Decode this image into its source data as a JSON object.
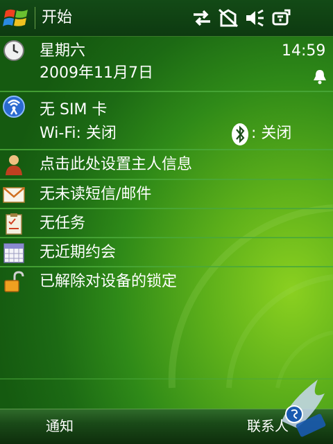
{
  "titlebar": {
    "title": "开始",
    "status_icons": [
      "connectivity-arrows-icon",
      "no-phone-icon",
      "speaker-mute-icon",
      "battery-plug-icon"
    ]
  },
  "today": {
    "date": {
      "weekday": "星期六",
      "date": "2009年11月7日",
      "time": "14:59",
      "icon": "clock-icon",
      "alarm_icon": "bell-icon"
    },
    "connectivity": {
      "sim": "无 SIM 卡",
      "wifi_label": "Wi-Fi:",
      "wifi_status": "关闭",
      "bt_status": ": 关闭",
      "icon": "wireless-icon",
      "bt_icon": "bluetooth-icon"
    },
    "items": [
      {
        "label": "点击此处设置主人信息",
        "icon": "owner-person-icon"
      },
      {
        "label": "无未读短信/邮件",
        "icon": "envelope-icon"
      },
      {
        "label": "无任务",
        "icon": "clipboard-tasks-icon"
      },
      {
        "label": "无近期约会",
        "icon": "calendar-icon"
      },
      {
        "label": "已解除对设备的锁定",
        "icon": "unlocked-padlock-icon"
      }
    ]
  },
  "softkeys": {
    "left": "通知",
    "right": "联系人"
  },
  "colors": {
    "title_bar": "#0d3a10",
    "separator": "#4aa83a",
    "background": "#2f8a18"
  }
}
